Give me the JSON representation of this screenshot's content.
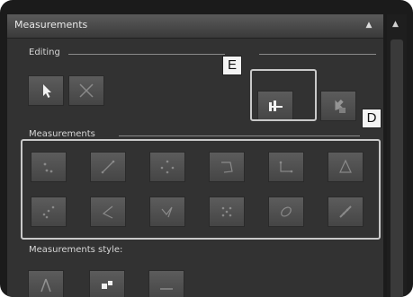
{
  "panel": {
    "title": "Measurements"
  },
  "sections": {
    "editing_label": "Editing",
    "measurements_label": "Measurements",
    "style_label": "Measurements style:"
  },
  "callouts": {
    "e": "E",
    "d": "D"
  },
  "editing_tools": [
    {
      "icon": "pointer-icon",
      "active": true
    },
    {
      "icon": "delete-cross-icon",
      "active": false
    },
    {
      "icon": "calibration-icon",
      "active": true
    },
    {
      "icon": "export-arrow-icon",
      "active": false
    }
  ],
  "measurement_tools_row1": [
    "dots-two-icon",
    "line-measure-icon",
    "circle-points-icon",
    "polyline-icon",
    "rectangle-icon",
    "triangle-icon"
  ],
  "measurement_tools_row2": [
    "angle-dots-icon",
    "angle-icon",
    "multi-point-icon",
    "grid-dots-icon",
    "ellipse-icon",
    "distance-icon"
  ],
  "style_tools": [
    "arrow-style-icon",
    "fill-style-icon",
    "line-style-icon"
  ],
  "colors": {
    "panel_bg": "#323232",
    "button": "#555555",
    "highlight_border": "#c9c9c9"
  }
}
